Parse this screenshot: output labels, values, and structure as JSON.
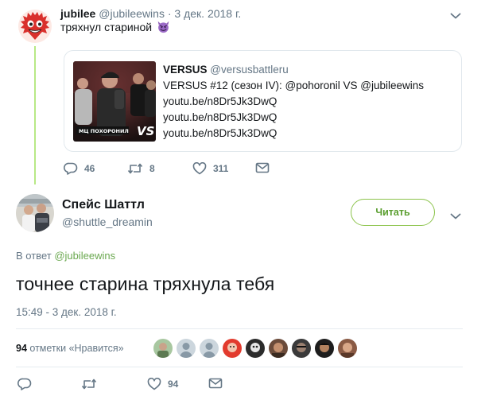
{
  "parent_tweet": {
    "author_name": "jubilee",
    "author_handle": "@jubileewins",
    "separator": "·",
    "date": "3 дек. 2018 г.",
    "text": "тряхнул стариной",
    "emoji": "smiling-imp-emoji",
    "card": {
      "name": "VERSUS",
      "handle": "@versusbattleru",
      "lines": [
        "VERSUS #12 (сезон IV): @pohoronil VS @jubileewins",
        "youtu.be/n8Dr5Jk3DwQ",
        "youtu.be/n8Dr5Jk3DwQ",
        "youtu.be/n8Dr5Jk3DwQ"
      ],
      "thumb_caption": "МЦ ПОХОРОНИЛ",
      "thumb_logo": "VS"
    },
    "actions": {
      "replies": "46",
      "retweets": "8",
      "likes": "311"
    }
  },
  "main_tweet": {
    "author_name": "Спейс Шаттл",
    "author_handle": "@shuttle_dreamin",
    "follow_label": "Читать",
    "reply_prefix": "В ответ",
    "reply_mention": "@jubileewins",
    "text": "точнее старина тряхнула тебя",
    "timestamp": "15:49 - 3 дек. 2018 г.",
    "likes_count": "94",
    "likes_label": "отметки «Нравится»",
    "actions": {
      "replies": "",
      "retweets": "",
      "likes": "94"
    }
  },
  "icons": {
    "caret": "chevron-down-icon",
    "reply": "reply-icon",
    "retweet": "retweet-icon",
    "like": "heart-icon",
    "dm": "envelope-icon"
  },
  "colors": {
    "accent_green": "#8bc34a",
    "thread_line": "#b8e986",
    "muted": "#657786",
    "text": "#14171a",
    "border": "#e1e8ed"
  }
}
